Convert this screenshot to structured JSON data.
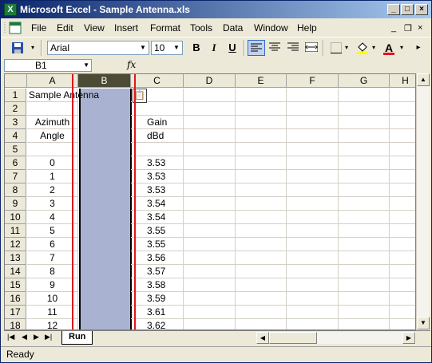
{
  "window": {
    "app_icon": "excel-icon",
    "title": "Microsoft Excel - Sample Antenna.xls",
    "controls": [
      "_",
      "□",
      "×"
    ]
  },
  "menubar": {
    "items": [
      "File",
      "Edit",
      "View",
      "Insert",
      "Format",
      "Tools",
      "Data",
      "Window",
      "Help"
    ],
    "doc_controls": [
      "_",
      "❐",
      "×"
    ]
  },
  "toolbar": {
    "font_name": "Arial",
    "font_size": "10",
    "bold": "B",
    "italic": "I",
    "underline": "U",
    "font_color_glyph": "A",
    "accent_red": "#e0161b"
  },
  "formula_bar": {
    "name_box": "B1",
    "fx_label": "fx",
    "formula": ""
  },
  "grid": {
    "columns": [
      "A",
      "B",
      "C",
      "D",
      "E",
      "F",
      "G",
      "H"
    ],
    "selected_column": "B",
    "rows": [
      {
        "n": "1",
        "a": "Sample Antenna",
        "c": ""
      },
      {
        "n": "2",
        "a": "",
        "c": ""
      },
      {
        "n": "3",
        "a": "Azimuth",
        "c": "Gain"
      },
      {
        "n": "4",
        "a": "Angle",
        "c": "dBd"
      },
      {
        "n": "5",
        "a": "",
        "c": ""
      },
      {
        "n": "6",
        "a": "0",
        "c": "3.53"
      },
      {
        "n": "7",
        "a": "1",
        "c": "3.53"
      },
      {
        "n": "8",
        "a": "2",
        "c": "3.53"
      },
      {
        "n": "9",
        "a": "3",
        "c": "3.54"
      },
      {
        "n": "10",
        "a": "4",
        "c": "3.54"
      },
      {
        "n": "11",
        "a": "5",
        "c": "3.55"
      },
      {
        "n": "12",
        "a": "6",
        "c": "3.55"
      },
      {
        "n": "13",
        "a": "7",
        "c": "3.56"
      },
      {
        "n": "14",
        "a": "8",
        "c": "3.57"
      },
      {
        "n": "15",
        "a": "9",
        "c": "3.58"
      },
      {
        "n": "16",
        "a": "10",
        "c": "3.59"
      },
      {
        "n": "17",
        "a": "11",
        "c": "3.61"
      },
      {
        "n": "18",
        "a": "12",
        "c": "3.62"
      }
    ],
    "selection_color": "#a9b3d1",
    "highlight_color": "#e0161b"
  },
  "sheet_tabs": {
    "active": "Run"
  },
  "status": {
    "text": "Ready"
  }
}
